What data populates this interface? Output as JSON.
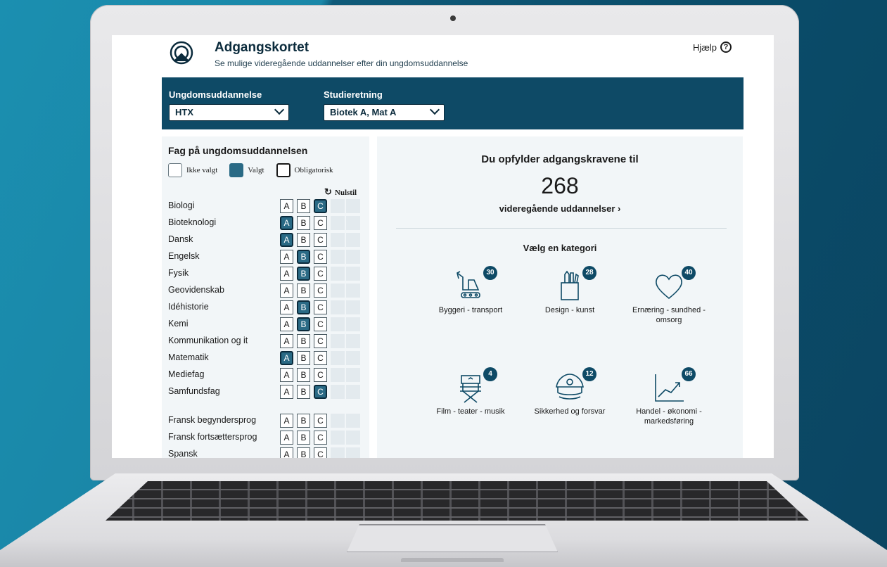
{
  "header": {
    "title": "Adgangskortet",
    "subtitle": "Se mulige videregående uddannelser efter din ungdomsuddannelse",
    "help_label": "Hjælp",
    "help_icon": "?"
  },
  "selectors": {
    "education_label": "Ungdomsuddannelse",
    "education_value": "HTX",
    "arrow": "»",
    "direction_label": "Studieretning",
    "direction_value": "Biotek A, Mat A"
  },
  "subjects_panel": {
    "title": "Fag på ungdomsuddannelsen",
    "legend": {
      "ikke_valgt": "Ikke valgt",
      "valgt": "Valgt",
      "obligatorisk": "Obligatorisk"
    },
    "reset_label": "Nulstil",
    "reset_icon": "↻",
    "level_labels": [
      "A",
      "B",
      "C"
    ],
    "subjects": [
      {
        "name": "Biologi",
        "selected": "C"
      },
      {
        "name": "Bioteknologi",
        "selected": "A"
      },
      {
        "name": "Dansk",
        "selected": "A"
      },
      {
        "name": "Engelsk",
        "selected": "B"
      },
      {
        "name": "Fysik",
        "selected": "B"
      },
      {
        "name": "Geovidenskab",
        "selected": ""
      },
      {
        "name": "Idéhistorie",
        "selected": "B"
      },
      {
        "name": "Kemi",
        "selected": "B"
      },
      {
        "name": "Kommunikation og it",
        "selected": ""
      },
      {
        "name": "Matematik",
        "selected": "A"
      },
      {
        "name": "Mediefag",
        "selected": ""
      },
      {
        "name": "Samfundsfag",
        "selected": "C"
      },
      {
        "name": "Fransk begyndersprog",
        "selected": ""
      },
      {
        "name": "Fransk fortsættersprog",
        "selected": ""
      },
      {
        "name": "Spansk",
        "selected": ""
      }
    ]
  },
  "results": {
    "heading": "Du opfylder adgangskravene til",
    "count": "268",
    "link_label": "videregående uddannelser ›",
    "category_heading": "Vælg en kategori",
    "categories": [
      {
        "label": "Byggeri - transport",
        "count": "30",
        "icon": "crane-icon"
      },
      {
        "label": "Design - kunst",
        "count": "28",
        "icon": "pencil-cup-icon"
      },
      {
        "label": "Ernæring - sundhed - omsorg",
        "count": "40",
        "icon": "heart-icon"
      },
      {
        "label": "Film - teater - musik",
        "count": "4",
        "icon": "director-chair-icon"
      },
      {
        "label": "Sikkerhed og forsvar",
        "count": "12",
        "icon": "police-cap-icon"
      },
      {
        "label": "Handel - økonomi - markedsføring",
        "count": "66",
        "icon": "chart-up-icon"
      }
    ]
  },
  "colors": {
    "brand": "#0e4a66",
    "selected": "#2a6a85",
    "panel": "#f2f6f8"
  }
}
